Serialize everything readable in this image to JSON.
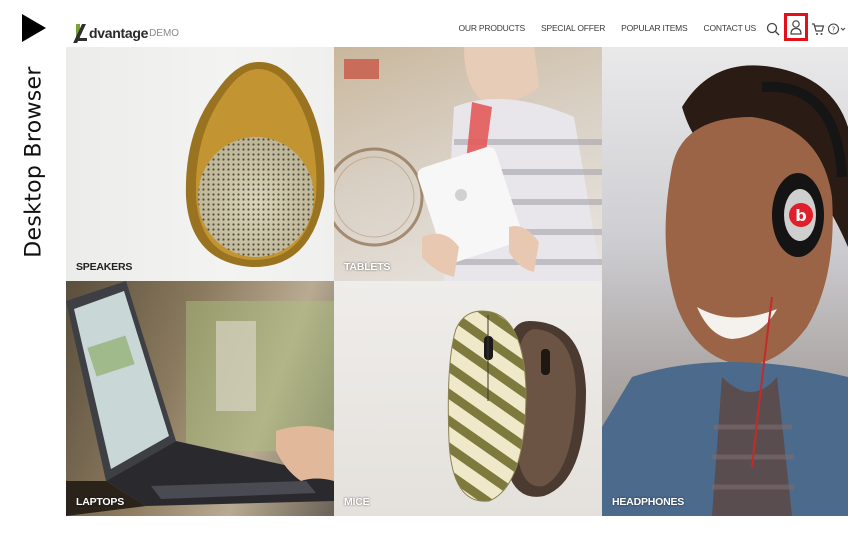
{
  "annotation": {
    "label": "Desktop Browser"
  },
  "header": {
    "logo_text": "dvantage",
    "logo_sub": "DEMO",
    "nav": [
      {
        "label": "OUR PRODUCTS"
      },
      {
        "label": "SPECIAL OFFER"
      },
      {
        "label": "POPULAR ITEMS"
      },
      {
        "label": "CONTACT US"
      }
    ],
    "icons": {
      "search": "search-icon",
      "user": "user-icon",
      "cart": "cart-icon",
      "help": "help-icon"
    },
    "highlight_color": "#e3101a"
  },
  "categories": [
    {
      "label": "SPEAKERS"
    },
    {
      "label": "TABLETS"
    },
    {
      "label": "HEADPHONES"
    },
    {
      "label": "LAPTOPS"
    },
    {
      "label": "MICE"
    }
  ],
  "colors": {
    "logo_accent": "#7aa33a",
    "text_dark": "#2a2a2a"
  }
}
